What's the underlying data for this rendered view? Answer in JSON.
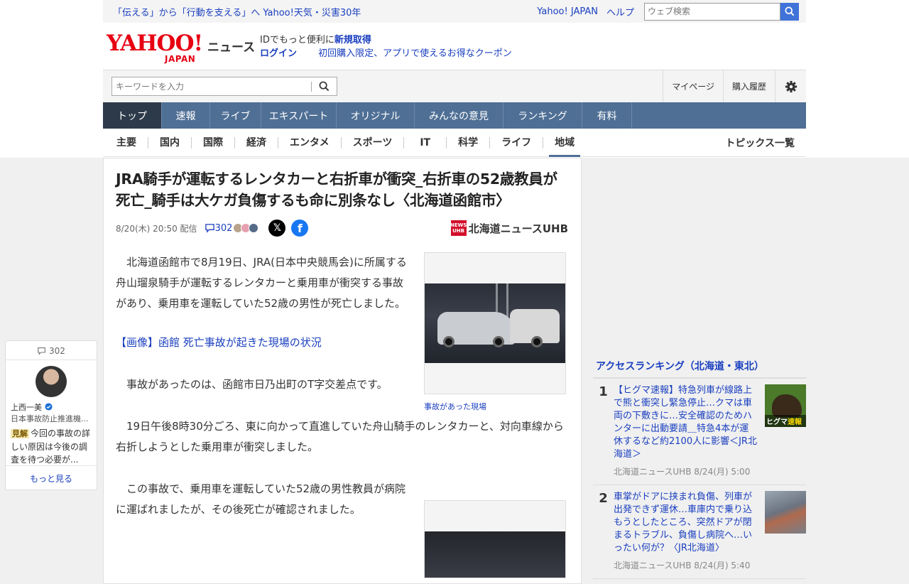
{
  "promo": {
    "link": "「伝える」から「行動を支える」へ Yahoo!天気・災害30年",
    "yahoo_japan": "Yahoo! JAPAN",
    "help": "ヘルプ",
    "web_search_placeholder": "ウェブ検索"
  },
  "logo": {
    "yahoo": "YAHOO!",
    "japan": "JAPAN",
    "news": "ニュース"
  },
  "id_box": {
    "prompt": "IDでもっと便利に",
    "signup": "新規取得",
    "login": "ログイン",
    "coupon": "初回購入限定、アプリで使えるお得なクーポン"
  },
  "search_row": {
    "keyword_placeholder": "キーワードを入力",
    "my_page": "マイページ",
    "purchase_history": "購入履歴"
  },
  "nav": {
    "tabs": [
      "トップ",
      "速報",
      "ライブ",
      "エキスパート",
      "オリジナル",
      "みんなの意見",
      "ランキング",
      "有料"
    ]
  },
  "subnav": {
    "items": [
      "主要",
      "国内",
      "国際",
      "経済",
      "エンタメ",
      "スポーツ",
      "IT",
      "科学",
      "ライフ",
      "地域"
    ],
    "topics": "トピックス一覧"
  },
  "article": {
    "title": "JRA騎手が運転するレンタカーと右折車が衝突_右折車の52歳教員が死亡_騎手は大ケガ負傷するも命に別条なし〈北海道函館市〉",
    "date": "8/20(木) 20:50",
    "date_suffix": "配信",
    "comment_count": "302",
    "source_badge": "NEWS UHB",
    "source_name": "北海道ニュースUHB",
    "p1": "北海道函館市で8月19日、JRA(日本中央競馬会)に所属する舟山瑠泉騎手が運転するレンタカーと乗用車が衝突する事故があり、乗用車を運転していた52歳の男性が死亡しました。",
    "link": "【画像】函館 死亡事故が起きた現場の状況",
    "p2": "事故があったのは、函館市日乃出町のT字交差点です。",
    "p3": "19日午後8時30分ごろ、東に向かって直進していた舟山騎手のレンタカーと、対向車線から右折しようとした乗用車が衝突しました。",
    "p4": "この事故で、乗用車を運転していた52歳の男性教員が病院に運ばれましたが、その後死亡が確認されました。",
    "fig1_caption": "事故があった現場"
  },
  "ranking": {
    "title": "アクセスランキング（北海道・東北）",
    "items": [
      {
        "rank": "1",
        "headline": "【ヒグマ速報】特急列車が線路上で熊と衝突し緊急停止…クマは車両の下敷きに…安全確認のためハンターに出動要請＿特急4本が運休するなど約2100人に影響＜JR北海道＞",
        "source": "北海道ニュースUHB 8/24(月) 5:00",
        "thumb_label_a": "ヒグマ",
        "thumb_label_b": "速報"
      },
      {
        "rank": "2",
        "headline": "車掌がドアに挟まれ負傷、列車が出発できず運休…車庫内で乗り込もうとしたところ、突然ドアが閉まるトラブル、負傷し病院へ…いったい何が？〈JR北海道〉",
        "source": "北海道ニュースUHB 8/24(月) 5:40"
      }
    ]
  },
  "comment_float": {
    "count": "302",
    "user_name": "上西一美",
    "user_role": "日本事故防止推進機...",
    "tag": "見解",
    "text": "今回の事故の詳しい原因は今後の調査を待つ必要が...",
    "more": "もっと見る"
  },
  "colors": {
    "link_blue": "#1a3fbf",
    "nav_bg": "#4f6f95",
    "nav_active": "#2d3a4a",
    "brand_red": "#e60012"
  }
}
